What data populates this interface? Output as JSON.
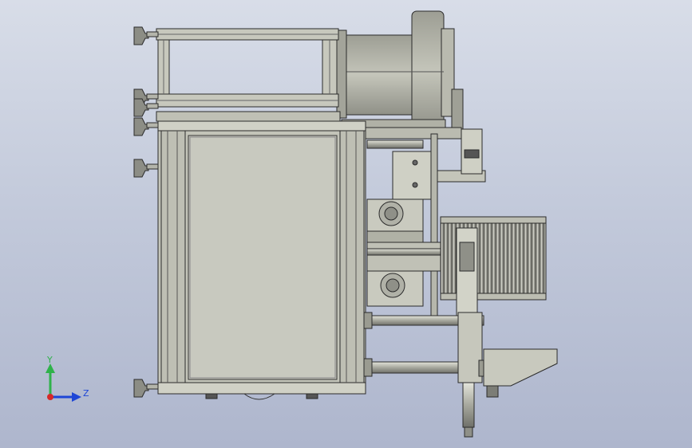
{
  "triad": {
    "y_label": "Y",
    "z_label": "Z",
    "x_color": "#d62828",
    "y_color": "#2fb24a",
    "z_color": "#1e46d6"
  },
  "colors": {
    "metal": "#c9cabd",
    "metal_dark": "#8d8f84",
    "drum": "#a9aa9f",
    "outline": "#2b2b2b",
    "rail": "#7d7f78",
    "panel": "#c8c9bf"
  }
}
